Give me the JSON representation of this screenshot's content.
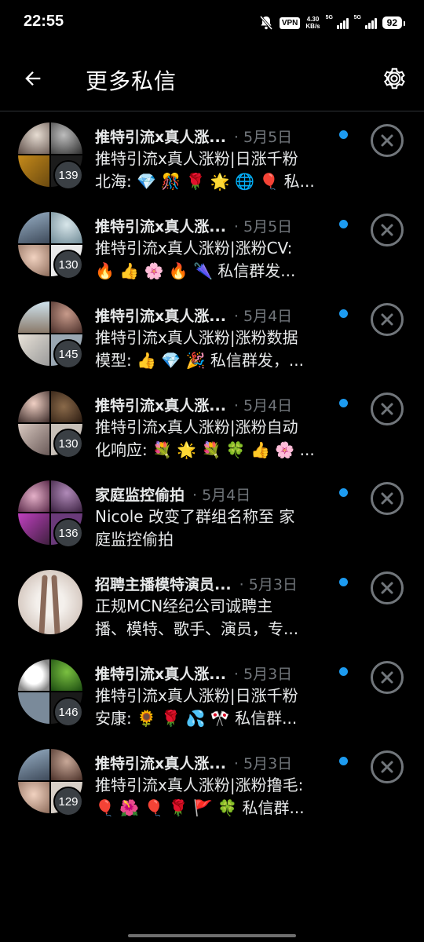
{
  "status_bar": {
    "time": "22:55",
    "vpn": "VPN",
    "speed_value": "4.30",
    "speed_unit": "KB/s",
    "sim1": "5G",
    "sim2": "5G",
    "battery": "92"
  },
  "header": {
    "title": "更多私信",
    "back_icon": "back-arrow-icon",
    "settings_icon": "gear-icon"
  },
  "colors": {
    "background": "#000000",
    "unread_dot": "#1d9bf0",
    "muted_text": "#71767b",
    "badge_bg": "#3a3f44"
  },
  "conversations": [
    {
      "name": "推特引流x真人涨...",
      "date": "· 5月5日",
      "line2": "推特引流x真人涨粉|日涨千粉",
      "line3": "北海: 💎 🎊 🌹 🌟 🌐 🎈 私...",
      "member_count": "139",
      "unread": true
    },
    {
      "name": "推特引流x真人涨...",
      "date": "· 5月5日",
      "line2": "推特引流x真人涨粉|涨粉CV:",
      "line3": "🔥 👍 🌸 🔥 🌂 私信群发...",
      "member_count": "130",
      "unread": true
    },
    {
      "name": "推特引流x真人涨...",
      "date": "· 5月4日",
      "line2": "推特引流x真人涨粉|涨粉数据",
      "line3": "模型: 👍 💎 🎉 私信群发，...",
      "member_count": "145",
      "unread": true
    },
    {
      "name": "推特引流x真人涨...",
      "date": "· 5月4日",
      "line2": "推特引流x真人涨粉|涨粉自动",
      "line3": "化响应: 💐 🌟 💐 🍀 👍 🌸 ...",
      "member_count": "130",
      "unread": true
    },
    {
      "name": "家庭监控偷拍",
      "date": "· 5月4日",
      "line2": "Nicole 改变了群组名称至 家",
      "line3": "庭监控偷拍",
      "member_count": "136",
      "unread": true
    },
    {
      "name": "招聘主播模特演员...",
      "date": "· 5月3日",
      "line2": "正规MCN经纪公司诚聘主",
      "line3": "播、模特、歌手、演员，专...",
      "member_count": "",
      "unread": true
    },
    {
      "name": "推特引流x真人涨...",
      "date": "· 5月3日",
      "line2": "推特引流x真人涨粉|日涨千粉",
      "line3": "安康: 🌻 🌹 💦 🎌 私信群...",
      "member_count": "146",
      "unread": true
    },
    {
      "name": "推特引流x真人涨...",
      "date": "· 5月3日",
      "line2": "推特引流x真人涨粉|涨粉撸毛:",
      "line3": "🎈 🌺 🎈 🌹 🚩 🍀 私信群...",
      "member_count": "129",
      "unread": true
    }
  ]
}
